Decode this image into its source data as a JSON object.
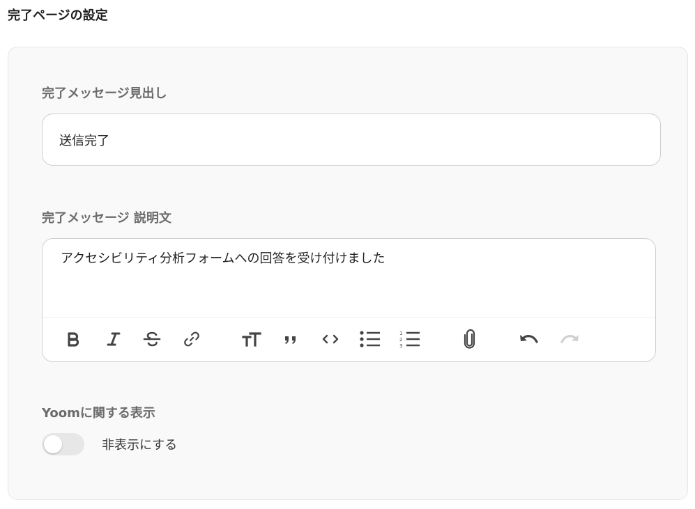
{
  "page_title": "完了ページの設定",
  "headline_section": {
    "label": "完了メッセージ見出し",
    "value": "送信完了"
  },
  "description_section": {
    "label": "完了メッセージ 説明文",
    "value": "アクセシビリティ分析フォームへの回答を受け付けました",
    "toolbar": [
      {
        "name": "bold-icon",
        "enabled": true
      },
      {
        "name": "italic-icon",
        "enabled": true
      },
      {
        "name": "strikethrough-icon",
        "enabled": true
      },
      {
        "name": "link-icon",
        "enabled": true
      },
      {
        "name": "text-size-icon",
        "enabled": true
      },
      {
        "name": "quote-icon",
        "enabled": true
      },
      {
        "name": "code-icon",
        "enabled": true
      },
      {
        "name": "bullet-list-icon",
        "enabled": true
      },
      {
        "name": "numbered-list-icon",
        "enabled": true
      },
      {
        "name": "attachment-icon",
        "enabled": true
      },
      {
        "name": "undo-icon",
        "enabled": true
      },
      {
        "name": "redo-icon",
        "enabled": false
      }
    ]
  },
  "yoom_section": {
    "label": "Yoomに関する表示",
    "toggle_label": "非表示にする",
    "toggle_on": false
  },
  "colors": {
    "panel_bg": "#f9f9f9",
    "label_gray": "#6b6b6b",
    "border": "#cfcfcf",
    "toggle_off": "#e7e7e7"
  }
}
